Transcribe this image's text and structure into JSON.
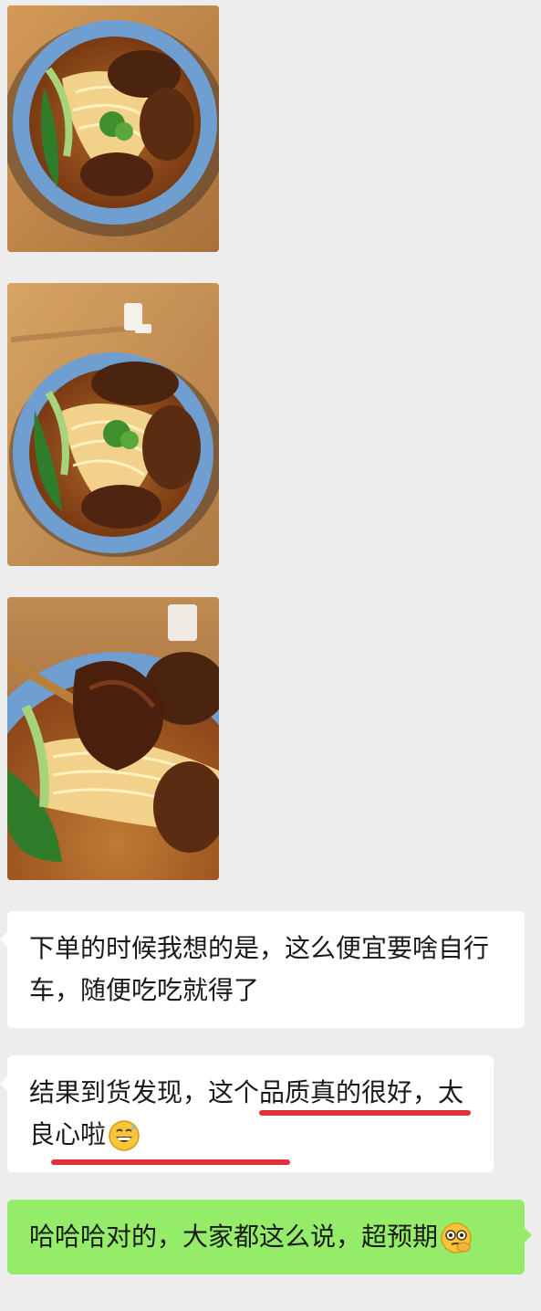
{
  "photos": [
    {
      "name": "beef-noodle-photo-1",
      "type": "food-photo"
    },
    {
      "name": "beef-noodle-photo-2",
      "type": "food-photo"
    },
    {
      "name": "beef-noodle-photo-3",
      "type": "food-photo"
    }
  ],
  "messages": [
    {
      "side": "left",
      "text": "下单的时候我想的是，这么便宜要啥自行车，随便吃吃就得了"
    },
    {
      "side": "left",
      "text_before": "结果到货发现，",
      "text_highlight_1": "这个品质真的很",
      "text_highlight_2": "好，太良心啦",
      "emoji": "grinning-sweat-emoji",
      "highlight_color": "#e0303a"
    },
    {
      "side": "right",
      "text": "哈哈哈对的，大家都这么说，超预期",
      "emoji": "thinking-face-emoji"
    }
  ],
  "colors": {
    "chat_background": "#ededed",
    "incoming_bubble": "#ffffff",
    "outgoing_bubble": "#95ec69"
  }
}
